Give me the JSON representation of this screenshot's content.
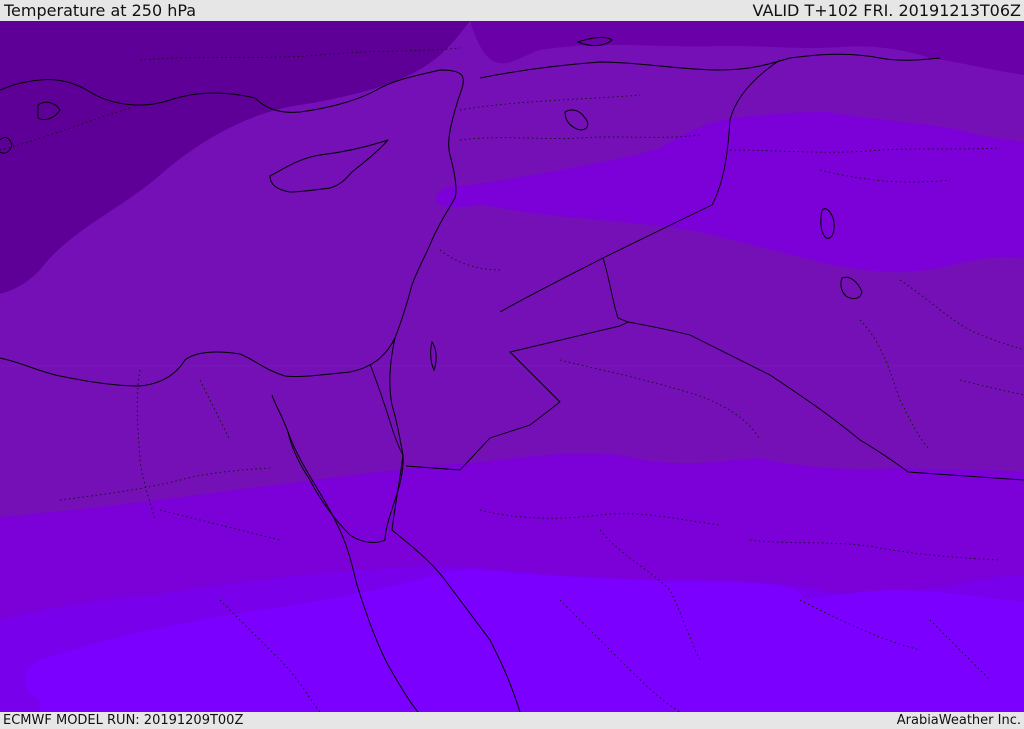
{
  "header": {
    "title": "Temperature at 250 hPa",
    "valid": "VALID T+102 FRI. 20191213T06Z"
  },
  "footer": {
    "model_run": "ECMWF MODEL RUN: 20191209T00Z",
    "credit": "ArabiaWeather Inc."
  },
  "map": {
    "fill_colors": {
      "darkest": "#5e0097",
      "dark": "#6900a8",
      "mid": "#7410b6",
      "bright": "#7c00d8",
      "brighter": "#7800ea",
      "brightest": "#7c00ff"
    },
    "line_color": "#000000"
  }
}
